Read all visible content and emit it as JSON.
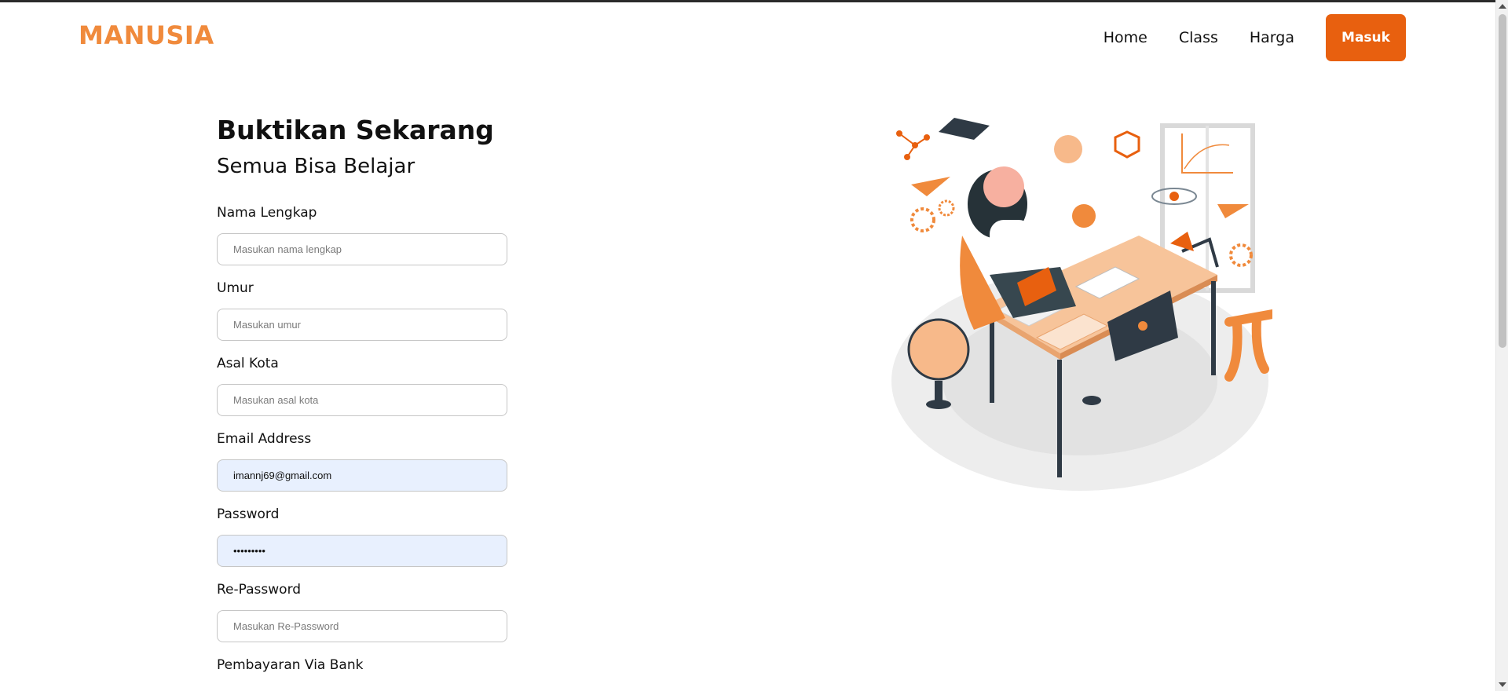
{
  "colors": {
    "brand": "#f08a3c",
    "accent": "#e8600f"
  },
  "header": {
    "brand": "MANUSIA",
    "nav": [
      "Home",
      "Class",
      "Harga"
    ],
    "login_label": "Masuk"
  },
  "hero": {
    "title": "Buktikan Sekarang",
    "subtitle": "Semua Bisa Belajar"
  },
  "form": {
    "fields": [
      {
        "label": "Nama Lengkap",
        "placeholder": "Masukan nama lengkap",
        "value": ""
      },
      {
        "label": "Umur",
        "placeholder": "Masukan umur",
        "value": ""
      },
      {
        "label": "Asal Kota",
        "placeholder": "Masukan asal kota",
        "value": ""
      },
      {
        "label": "Email Address",
        "placeholder": "",
        "value": "imannj69@gmail.com"
      },
      {
        "label": "Password",
        "placeholder": "",
        "value": "•••••••••"
      },
      {
        "label": "Re-Password",
        "placeholder": "Masukan Re-Password",
        "value": ""
      }
    ],
    "bank_label": "Pembayaran Via Bank"
  },
  "illustration": {
    "icon": "student-studying-illustration"
  }
}
